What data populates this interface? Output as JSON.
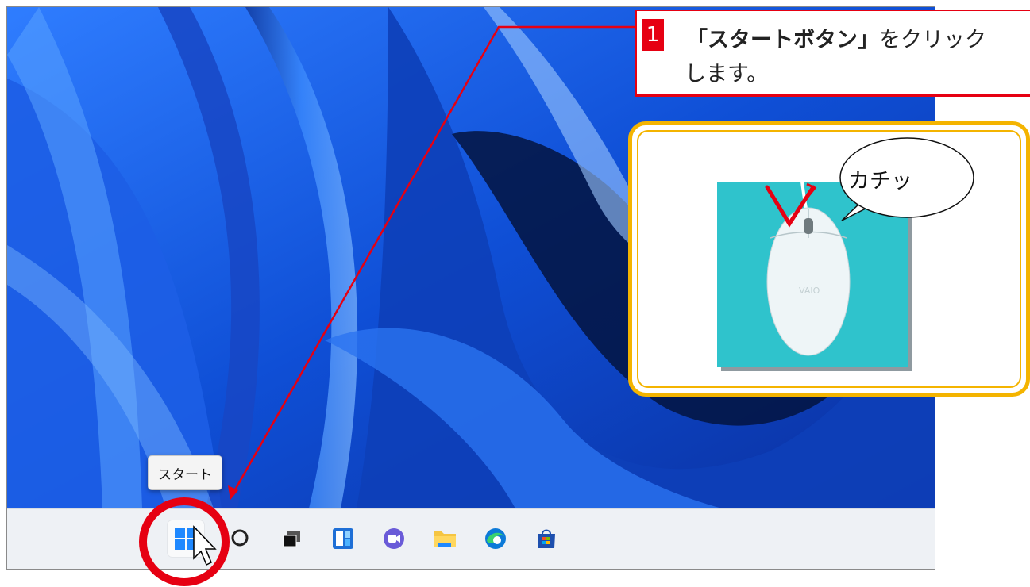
{
  "tooltip": {
    "label": "スタート"
  },
  "callout": {
    "step_number": "1",
    "line1_bold": "「スタートボタン」",
    "line1_rest": "をクリック",
    "line2": "します。"
  },
  "mouse_illustration": {
    "bubble_text": "カチッ",
    "brand_text": "VAIO"
  },
  "taskbar": {
    "icons": [
      "start-icon",
      "search-icon",
      "task-view-icon",
      "widgets-icon",
      "chat-icon",
      "file-explorer-icon",
      "edge-icon",
      "store-icon"
    ]
  },
  "colors": {
    "accent_red": "#e60012",
    "frame_yellow": "#f4b400",
    "wallpaper_blue": "#1a5ee8"
  }
}
